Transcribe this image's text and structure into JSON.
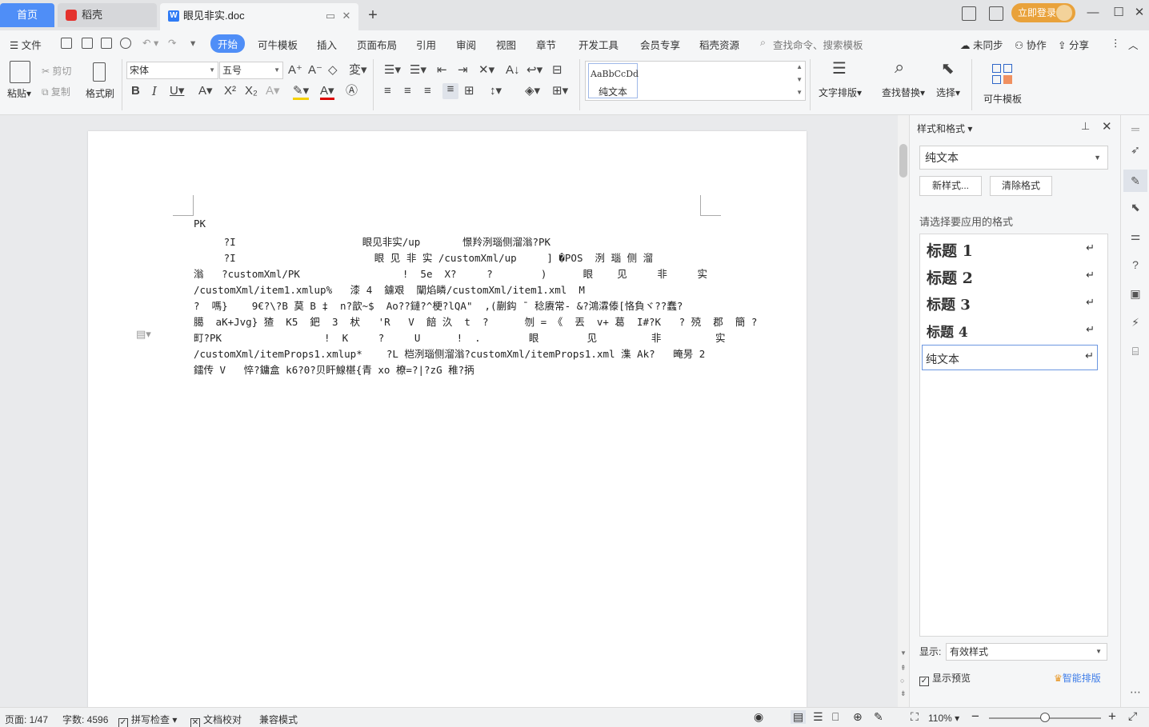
{
  "titlebar": {
    "home_tab": "首页",
    "dao_tab": "稻壳",
    "doc_tab": "眼见非实.doc",
    "login": "立即登录"
  },
  "menubar": {
    "file": "文件",
    "items": [
      "开始",
      "可牛模板",
      "插入",
      "页面布局",
      "引用",
      "审阅",
      "视图",
      "章节",
      "开发工具",
      "会员专享",
      "稻壳资源"
    ],
    "search_placeholder": "查找命令、搜索模板",
    "sync": "未同步",
    "collab": "协作",
    "share": "分享"
  },
  "ribbon": {
    "paste": "粘贴",
    "cut": "剪切",
    "copy": "复制",
    "format_painter": "格式刷",
    "font_name": "宋体",
    "font_size": "五号",
    "style_sample": "AaBbCcDd",
    "style_name": "纯文本",
    "text_layout": "文字排版",
    "find_replace": "查找替换",
    "select": "选择",
    "keniu_template": "可牛模板"
  },
  "document": {
    "lines": [
      "PK",
      "     ?I                     眼见非实/up       憬羚洌瑙侧溜滃?PK",
      "     ?I                       眼 见 非 实 /customXml/up     ] �POS  洌 瑙 侧 溜",
      "滃   ?customXml/PK                 !  5e  X?     ?        )      眼    见     非     实",
      "/customXml/item1.xmlup%   漆 4  鐪艰  闡焰瞵/customXml/item1.xml  M",
      "?  嗎}    9€?\\?B 莫 B ‡  n?歆~$  Ao??鏈?^梗?lQA\"  ,(蒯鈎 ¯ 稔赓常- &?鴻瀮傣[恪負ヾ??蠢?",
      "臈  aK+Jvg} 猹  K5  鈀  3  枤   'R   V  餢 汣  t  ?      刎 = 《  丟  v+ 葛  I#?K   ? 殑  郡  簡 ?",
      "町?PK                 !  K     ?     U      !  .        眼        见         非         实",
      "/customXml/itemProps1.xmlup*    ?L 桤洌瑙侧溜滃?customXml/itemProps1.xml 潗 Ak?   晻昘 2",
      "鐳传 V   悴?鏞盒 k6?0?贝盰鰁椹{青 xo 橑=?|?zG 稚?抦"
    ]
  },
  "panel": {
    "title": "样式和格式",
    "current_style": "纯文本",
    "new_style": "新样式...",
    "clear_format": "清除格式",
    "choose_label": "请选择要应用的格式",
    "styles": [
      "标题  1",
      "标题  2",
      "标题  3",
      "标题  4",
      "纯文本"
    ],
    "show_label": "显示:",
    "show_value": "有效样式",
    "preview": "显示预览",
    "smart_layout": "智能排版"
  },
  "statusbar": {
    "page": "页面: 1/47",
    "words": "字数: 4596",
    "spell": "拼写检查",
    "proof": "文档校对",
    "compat": "兼容模式",
    "zoom": "110%"
  }
}
